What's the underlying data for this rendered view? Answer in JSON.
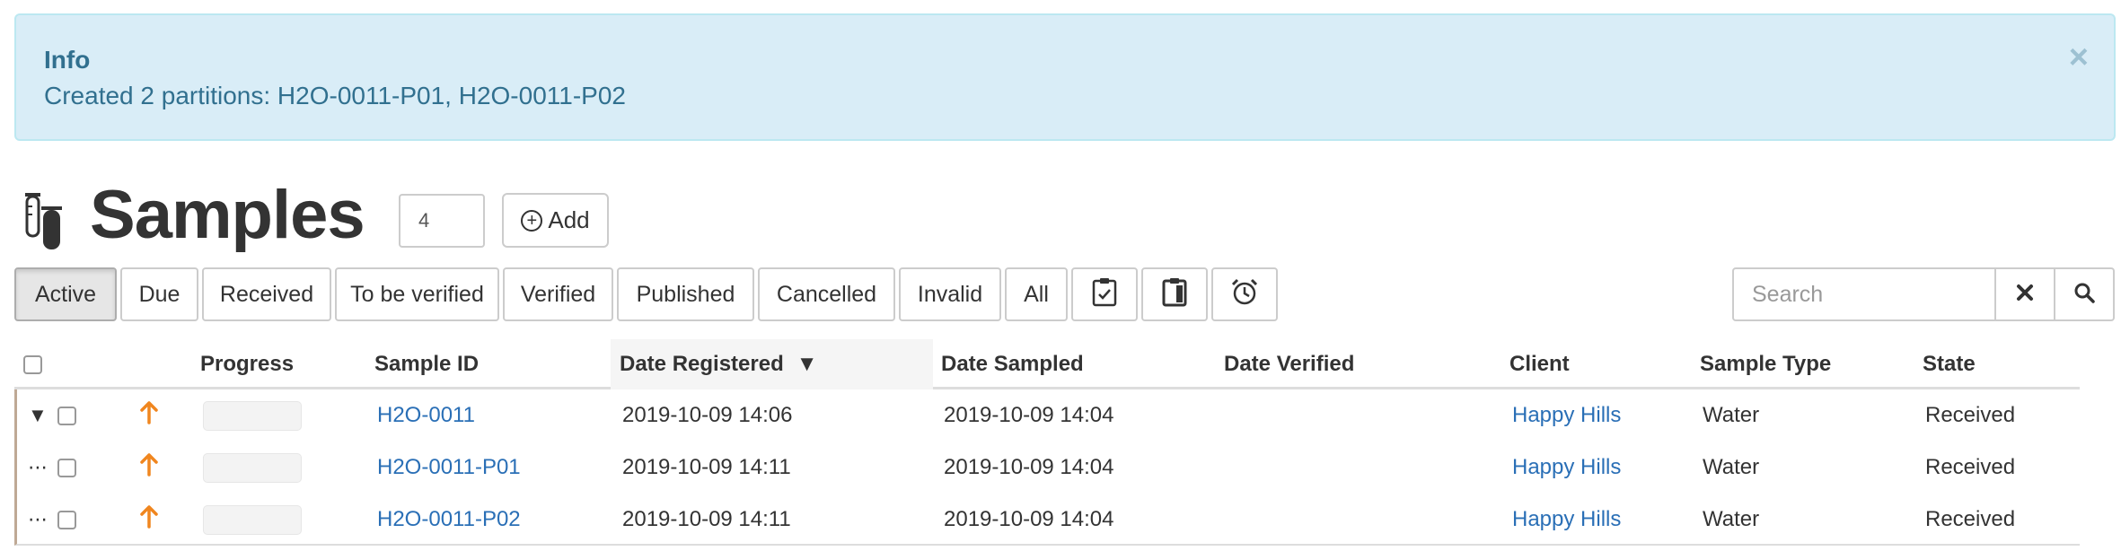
{
  "alert": {
    "title": "Info",
    "message": "Created 2 partitions: H2O-0011-P01, H2O-0011-P02",
    "close_glyph": "×"
  },
  "header": {
    "title": "Samples",
    "count_value": "4",
    "add_label": "Add",
    "icon": "test-tubes-icon"
  },
  "filters": {
    "buttons": [
      "Active",
      "Due",
      "Received",
      "To be verified",
      "Verified",
      "Published",
      "Cancelled",
      "Invalid",
      "All"
    ],
    "active": "Active",
    "icon_buttons": [
      "clipboard-check-icon",
      "clipboard-icon",
      "alarm-clock-icon"
    ]
  },
  "search": {
    "placeholder": "Search"
  },
  "table": {
    "columns": {
      "progress": "Progress",
      "sample_id": "Sample ID",
      "date_registered": "Date Registered",
      "date_sampled": "Date Sampled",
      "date_verified": "Date Verified",
      "client": "Client",
      "sample_type": "Sample Type",
      "state": "State"
    },
    "sort_indicator": "▼",
    "rows": [
      {
        "expand": "▼",
        "sample_id": "H2O-0011",
        "date_registered": "2019-10-09 14:06",
        "date_sampled": "2019-10-09 14:04",
        "date_verified": "",
        "client": "Happy Hills",
        "sample_type": "Water",
        "state": "Received",
        "priority_icon": "arrow-up-icon"
      },
      {
        "expand": "⋯",
        "sample_id": "H2O-0011-P01",
        "date_registered": "2019-10-09 14:11",
        "date_sampled": "2019-10-09 14:04",
        "date_verified": "",
        "client": "Happy Hills",
        "sample_type": "Water",
        "state": "Received",
        "priority_icon": "arrow-up-icon"
      },
      {
        "expand": "⋯",
        "sample_id": "H2O-0011-P02",
        "date_registered": "2019-10-09 14:11",
        "date_sampled": "2019-10-09 14:04",
        "date_verified": "",
        "client": "Happy Hills",
        "sample_type": "Water",
        "state": "Received",
        "priority_icon": "arrow-up-icon"
      }
    ]
  },
  "colors": {
    "alert_bg": "#d9edf7",
    "alert_text": "#31708f",
    "link": "#2a6fb6",
    "priority_arrow": "#f0861f"
  }
}
